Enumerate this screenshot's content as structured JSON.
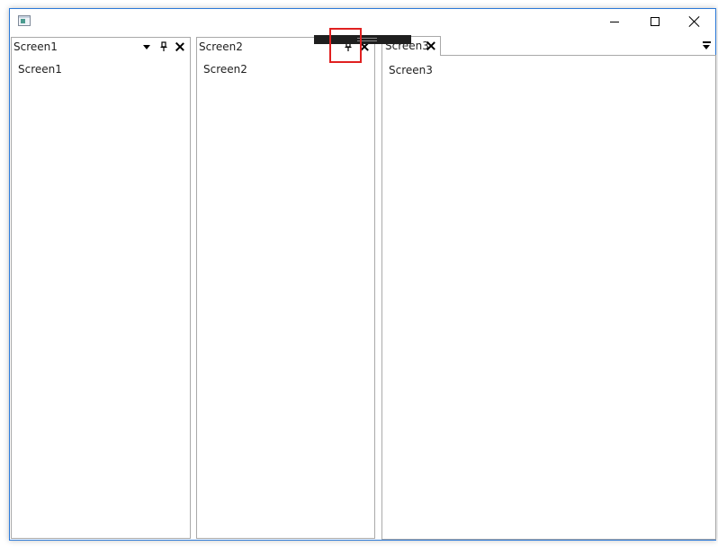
{
  "window": {
    "title": "",
    "controls": {
      "minimize": "minimize",
      "maximize": "maximize",
      "close": "close"
    }
  },
  "panes": [
    {
      "title": "Screen1",
      "content": "Screen1",
      "buttons": [
        "dropdown-icon",
        "pin-icon",
        "close-icon"
      ]
    },
    {
      "title": "Screen2",
      "content": "Screen2",
      "buttons": [
        "pin-icon",
        "close-icon"
      ]
    }
  ],
  "document": {
    "tabs": [
      {
        "label": "Screen3",
        "active": true
      }
    ],
    "content": "Screen3"
  },
  "colors": {
    "window_border": "#2b79d8",
    "pane_border": "#a9a9a9",
    "drag_bar": "#1f1f1f",
    "highlight": "#e02020"
  }
}
